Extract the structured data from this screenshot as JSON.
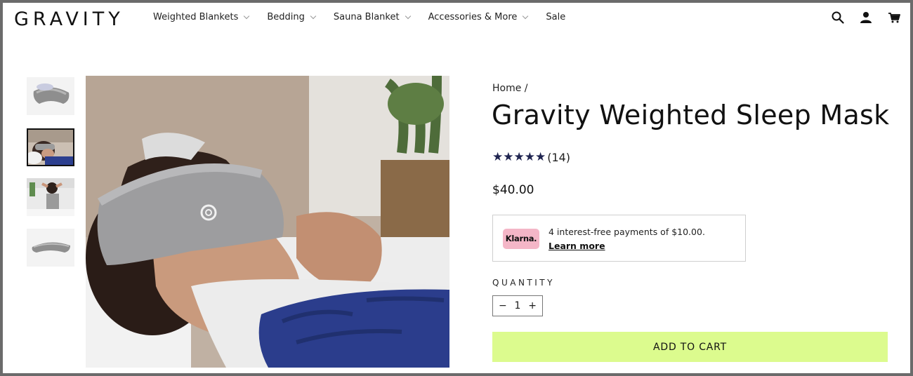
{
  "brand": {
    "logo": "GRAVITY"
  },
  "nav": {
    "items": [
      {
        "label": "Weighted Blankets",
        "has_dropdown": true
      },
      {
        "label": "Bedding",
        "has_dropdown": true
      },
      {
        "label": "Sauna Blanket",
        "has_dropdown": true
      },
      {
        "label": "Accessories & More",
        "has_dropdown": true
      },
      {
        "label": "Sale",
        "has_dropdown": false
      }
    ],
    "icons": [
      "search-icon",
      "account-icon",
      "cart-icon"
    ]
  },
  "gallery": {
    "thumbnails": [
      "mask-product-angle",
      "woman-wearing-mask",
      "woman-adjusting-mask",
      "mask-product-flat"
    ],
    "active_index": 1
  },
  "product": {
    "breadcrumb": "Home /",
    "title": "Gravity Weighted Sleep Mask",
    "rating_stars": 5,
    "review_count": "(14)",
    "price": "$40.00"
  },
  "klarna": {
    "badge": "Klarna.",
    "text": "4 interest-free payments of $10.00.",
    "link": "Learn more"
  },
  "quantity": {
    "label": "QUANTITY",
    "minus": "−",
    "value": "1",
    "plus": "+"
  },
  "cart": {
    "button_label": "ADD TO CART"
  },
  "colors": {
    "accent_button": "#dcfb8e",
    "star": "#1f2450",
    "klarna_pink": "#f4b6c7"
  }
}
